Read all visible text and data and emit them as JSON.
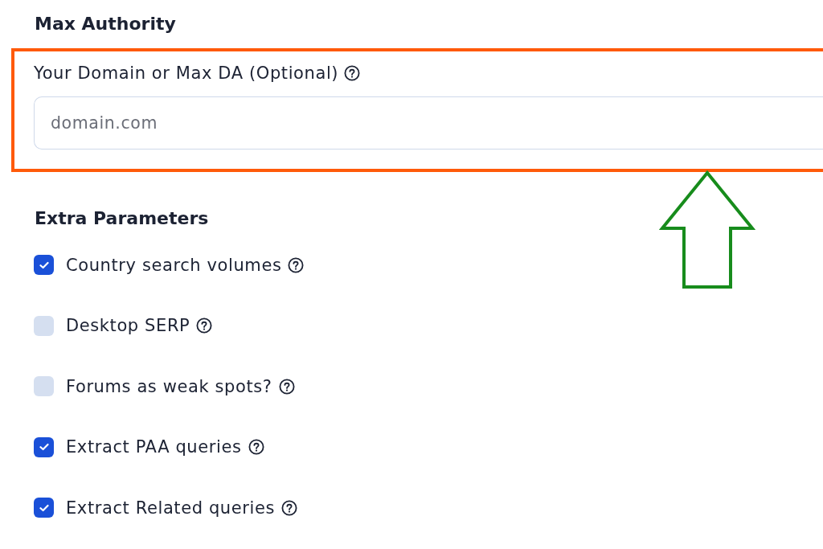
{
  "max_authority": {
    "heading": "Max Authority",
    "field": {
      "label": "Your Domain or Max DA (Optional)",
      "placeholder": "domain.com",
      "highlighted": true
    }
  },
  "extra_parameters": {
    "heading": "Extra Parameters",
    "options": [
      {
        "label": "Country search volumes",
        "checked": true
      },
      {
        "label": "Desktop SERP",
        "checked": false
      },
      {
        "label": "Forums as weak spots?",
        "checked": false
      },
      {
        "label": "Extract PAA queries",
        "checked": true
      },
      {
        "label": "Extract Related queries",
        "checked": true
      }
    ]
  }
}
